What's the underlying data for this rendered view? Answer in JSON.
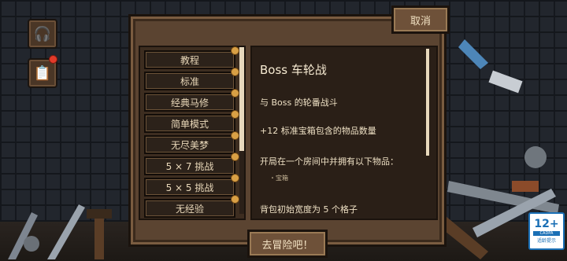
{
  "header": {
    "cancel_label": "取消"
  },
  "modes": [
    {
      "label": "教程",
      "selected": false
    },
    {
      "label": "标准",
      "selected": false
    },
    {
      "label": "经典马修",
      "selected": false
    },
    {
      "label": "简单模式",
      "selected": false
    },
    {
      "label": "无尽美梦",
      "selected": false
    },
    {
      "label": "5 × 7 挑战",
      "selected": false
    },
    {
      "label": "5 × 5 挑战",
      "selected": false
    },
    {
      "label": "无经验",
      "selected": false
    }
  ],
  "detail": {
    "title": "Boss 车轮战",
    "line1": "与 Boss 的轮番战斗",
    "line2": "+12 标准宝箱包含的物品数量",
    "line3": "开局在一个房间中并拥有以下物品：",
    "item": "・宝箱",
    "line4": "背包初始宽度为 5 个格子"
  },
  "footer": {
    "go_label": "去冒险吧！"
  },
  "rating": {
    "age": "12+",
    "org": "CADPA",
    "tip": "适龄提示"
  },
  "colors": {
    "panel": "#5b4431",
    "accent": "#d9a045",
    "text": "#eee0c4"
  }
}
